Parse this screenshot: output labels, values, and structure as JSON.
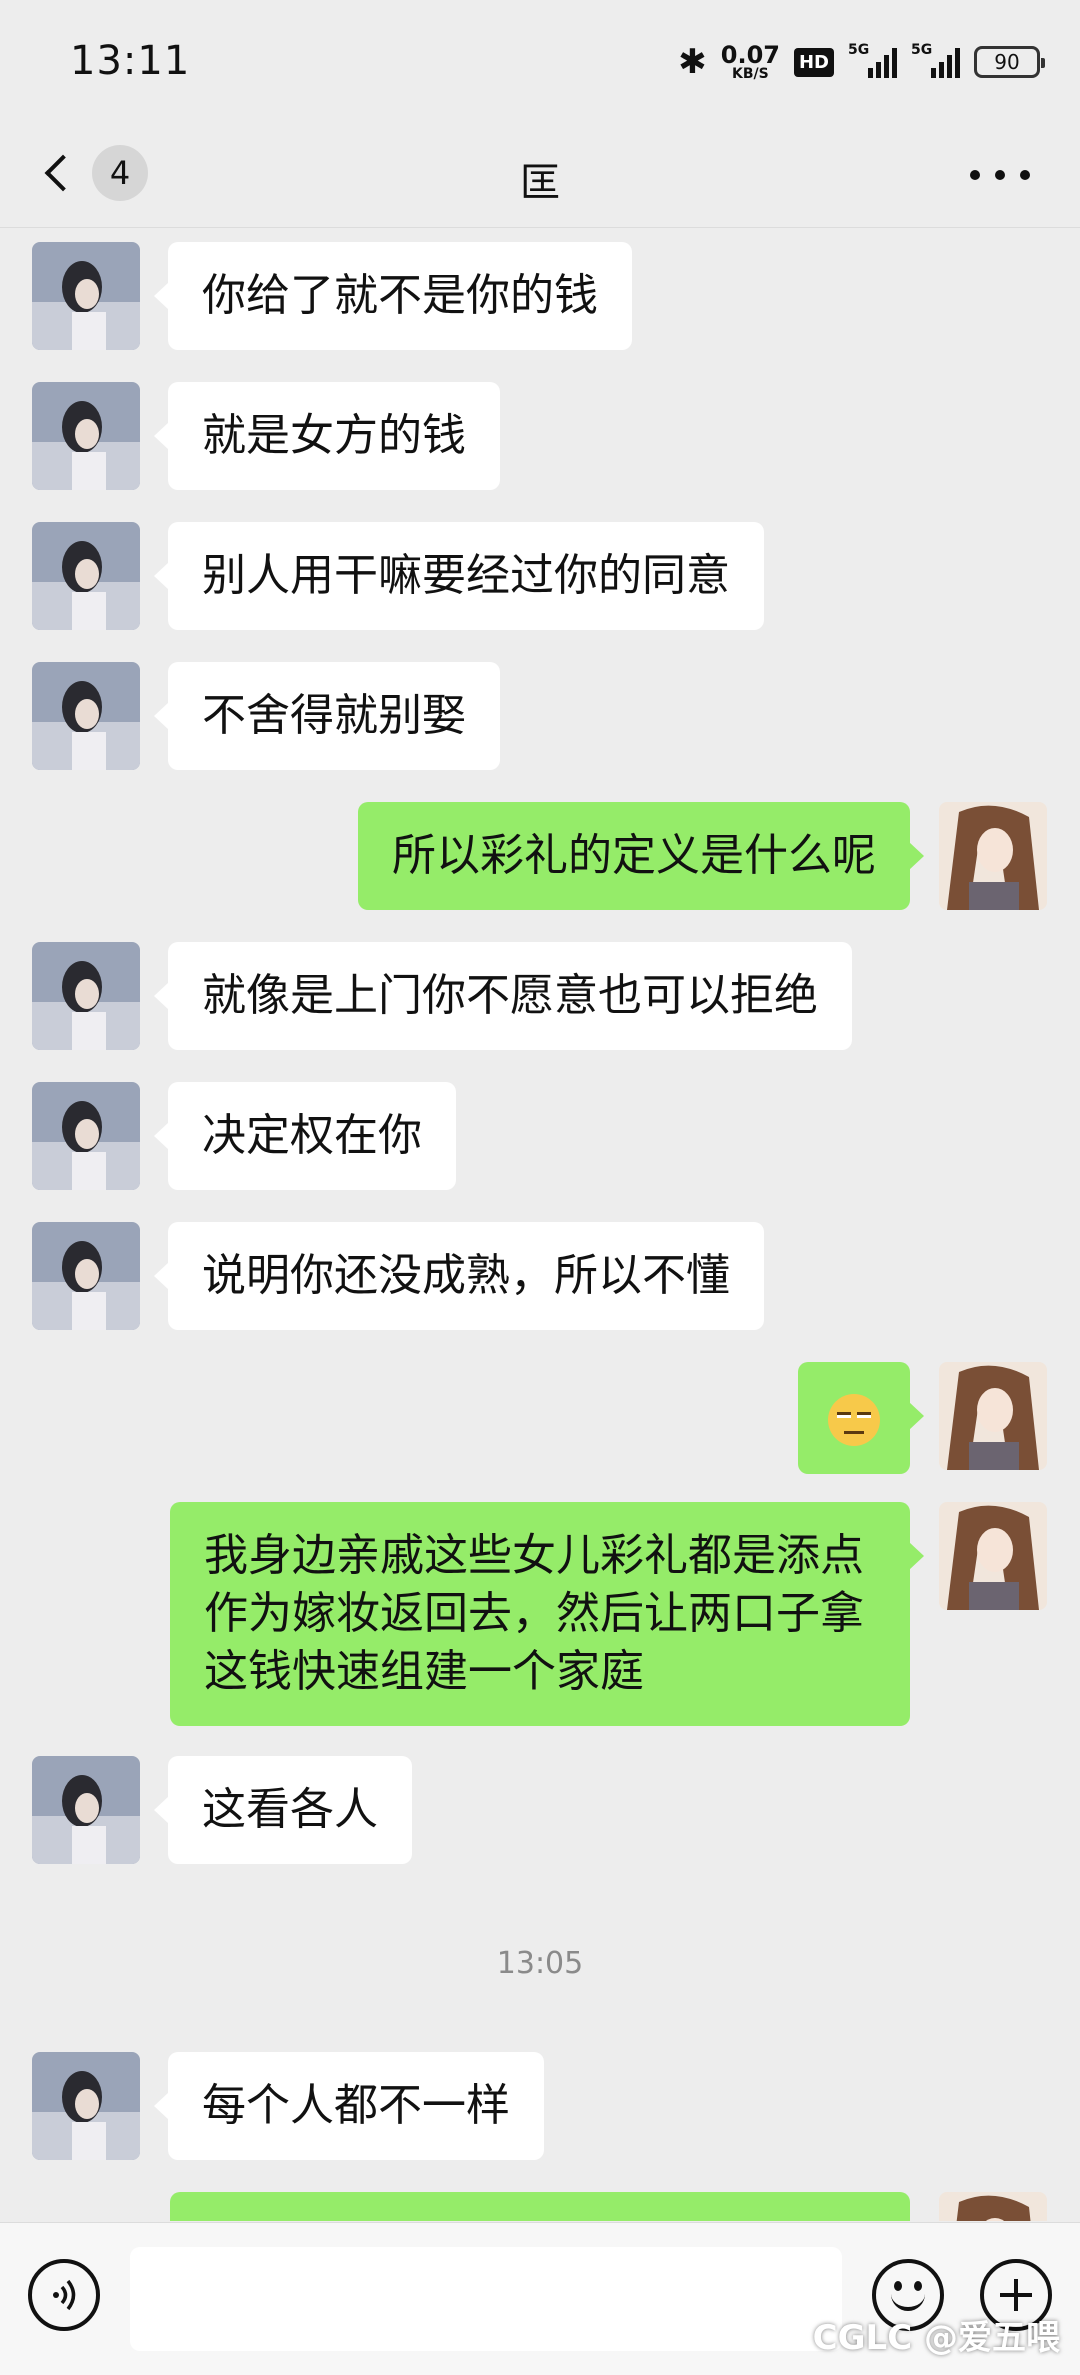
{
  "status_bar": {
    "time": "13:11",
    "bluetooth_icon": "bluetooth-icon",
    "net_speed_value": "0.07",
    "net_speed_unit": "KB/S",
    "hd_badge": "HD",
    "signal1_label": "5G",
    "signal2_label": "5G",
    "battery_level": "90"
  },
  "nav": {
    "unread_count": "4",
    "title": "匡",
    "back_icon": "chevron-left-icon",
    "more_icon": "more-dots-icon"
  },
  "messages": [
    {
      "side": "in",
      "text": "你给了就不是你的钱"
    },
    {
      "side": "in",
      "text": "就是女方的钱"
    },
    {
      "side": "in",
      "text": "别人用干嘛要经过你的同意"
    },
    {
      "side": "in",
      "text": "不舍得就别娶"
    },
    {
      "side": "out",
      "text": "所以彩礼的定义是什么呢"
    },
    {
      "side": "in",
      "text": "就像是上门你不愿意也可以拒绝"
    },
    {
      "side": "in",
      "text": "决定权在你"
    },
    {
      "side": "in",
      "text": "说明你还没成熟，所以不懂"
    },
    {
      "side": "out",
      "emoji": "eye-roll-face-emoji"
    },
    {
      "side": "out",
      "text": "我身边亲戚这些女儿彩礼都是添点作为嫁妆返回去，然后让两口子拿这钱快速组建一个家庭"
    },
    {
      "side": "in",
      "text": "这看各人"
    },
    {
      "side": "in",
      "text": "每个人都不一样"
    }
  ],
  "timestamp": "13:05",
  "input_bar": {
    "voice_icon": "voice-icon",
    "emoji_icon": "emoji-smile-icon",
    "plus_icon": "plus-circle-icon",
    "input_value": ""
  },
  "watermark": "CGLC @爱五喂",
  "colors": {
    "background": "#ededed",
    "incoming_bubble": "#ffffff",
    "outgoing_bubble": "#95ec69"
  }
}
